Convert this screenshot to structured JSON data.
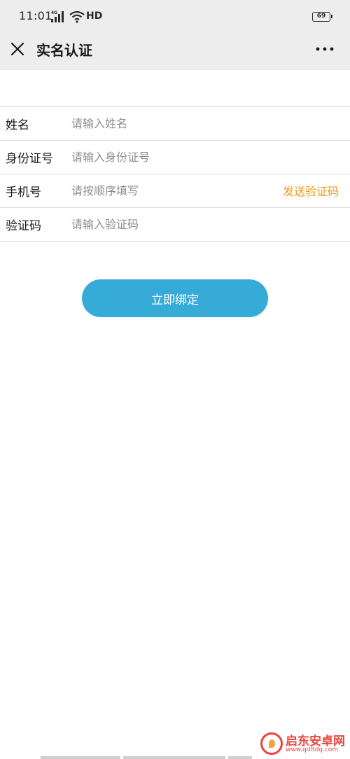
{
  "status_bar": {
    "time": "11:01",
    "network": "4G",
    "hd": "HD",
    "battery": "69"
  },
  "nav": {
    "title": "实名认证",
    "close_icon": "close-icon",
    "more_icon": "more-icon"
  },
  "form": {
    "rows": [
      {
        "label": "姓名",
        "placeholder": "请输入姓名",
        "value": ""
      },
      {
        "label": "身份证号",
        "placeholder": "请输入身份证号",
        "value": ""
      },
      {
        "label": "手机号",
        "placeholder": "请按顺序填写",
        "value": ""
      },
      {
        "label": "验证码",
        "placeholder": "请输入验证码",
        "value": ""
      }
    ],
    "send_code_label": "发送验证码"
  },
  "actions": {
    "bind_label": "立即绑定"
  },
  "watermark": {
    "name": "启东安卓网",
    "url": "www.qdltdq.com"
  },
  "colors": {
    "accent": "#37abd8",
    "send_code": "#f29b1c",
    "header_bg": "#ededed",
    "watermark": "#e8453c"
  }
}
